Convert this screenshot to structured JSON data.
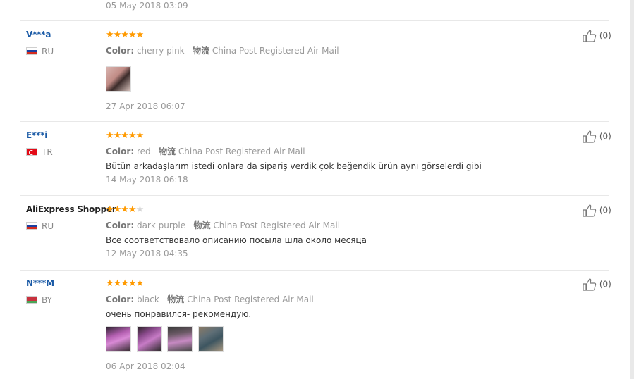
{
  "reviews": [
    {
      "date": "05 May 2018 03:09"
    },
    {
      "user": "V***a",
      "country": "RU",
      "stars": "★★★★★",
      "empty_stars": "",
      "color_label": "Color:",
      "color_value": "cherry pink",
      "logistics_label": "物流",
      "logistics_value": "China Post Registered Air Mail",
      "likes": "(0)",
      "date": "27 Apr 2018 06:07"
    },
    {
      "user": "E***i",
      "country": "TR",
      "stars": "★★★★★",
      "empty_stars": "",
      "color_label": "Color:",
      "color_value": "red",
      "logistics_label": "物流",
      "logistics_value": "China Post Registered Air Mail",
      "text": "Bütün arkadaşlarım istedi onlara da sipariş verdik çok beğendik ürün aynı görselerdi gibi",
      "likes": "(0)",
      "date": "14 May 2018 06:18"
    },
    {
      "user": "AliExpress Shopper",
      "country": "RU",
      "stars": "★★★★",
      "empty_stars": "★",
      "color_label": "Color:",
      "color_value": "dark purple",
      "logistics_label": "物流",
      "logistics_value": "China Post Registered Air Mail",
      "text": "Все соответствовало описанию посыла шла около месяца",
      "likes": "(0)",
      "date": "12 May 2018 04:35"
    },
    {
      "user": "N***M",
      "country": "BY",
      "stars": "★★★★★",
      "empty_stars": "",
      "color_label": "Color:",
      "color_value": "black",
      "logistics_label": "物流",
      "logistics_value": "China Post Registered Air Mail",
      "text": "очень понравился- рекомендую.",
      "likes": "(0)",
      "date": "06 Apr 2018 02:04"
    }
  ],
  "icons": {
    "like": "thumbs-up-icon",
    "star": "star-icon"
  },
  "colors": {
    "username": "#1a5aa6",
    "stars": "#ff9a00",
    "divider": "#e8e8e8"
  }
}
